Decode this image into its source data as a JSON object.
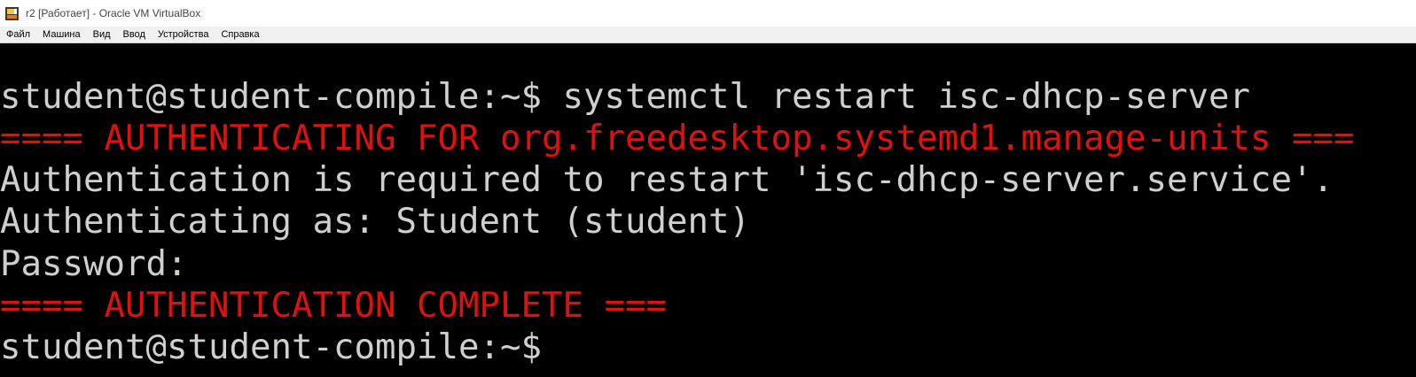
{
  "window": {
    "title": "r2 [Работает] - Oracle VM VirtualBox",
    "icon": "virtualbox-icon"
  },
  "menubar": {
    "items": [
      {
        "label": "Файл"
      },
      {
        "label": "Машина"
      },
      {
        "label": "Вид"
      },
      {
        "label": "Ввод"
      },
      {
        "label": "Устройства"
      },
      {
        "label": "Справка"
      }
    ]
  },
  "terminal": {
    "colors": {
      "background": "#000000",
      "text": "#cfcfcf",
      "alert": "#e01010"
    },
    "lines": [
      {
        "text": "student@student-compile:~$ systemctl restart isc-dhcp-server",
        "style": "normal"
      },
      {
        "text": "==== AUTHENTICATING FOR org.freedesktop.systemd1.manage-units ===",
        "style": "red"
      },
      {
        "text": "Authentication is required to restart 'isc-dhcp-server.service'.",
        "style": "normal"
      },
      {
        "text": "Authenticating as: Student (student)",
        "style": "normal"
      },
      {
        "text": "Password:",
        "style": "normal"
      },
      {
        "text": "==== AUTHENTICATION COMPLETE ===",
        "style": "red"
      },
      {
        "text": "student@student-compile:~$",
        "style": "normal"
      }
    ]
  }
}
